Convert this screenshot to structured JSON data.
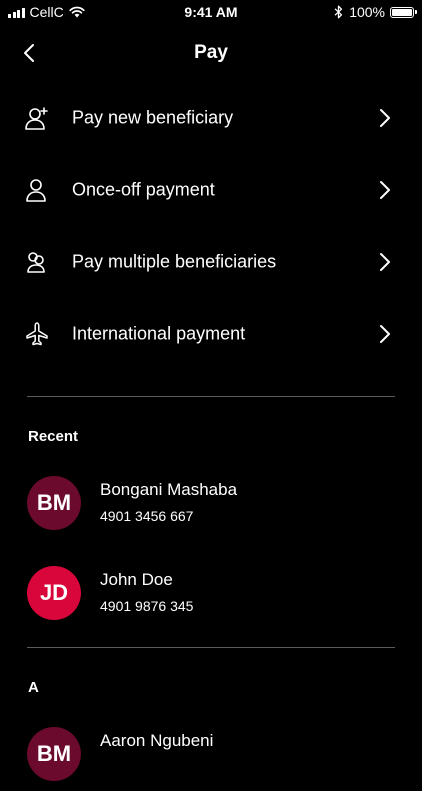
{
  "status_bar": {
    "carrier": "CellC",
    "time": "9:41 AM",
    "battery": "100%"
  },
  "header": {
    "title": "Pay",
    "back_icon": "chevron-left-icon"
  },
  "menu": [
    {
      "label": "Pay new beneficiary",
      "icon": "add-person-icon"
    },
    {
      "label": "Once-off payment",
      "icon": "person-icon"
    },
    {
      "label": "Pay multiple beneficiaries",
      "icon": "multiple-people-icon"
    },
    {
      "label": "International payment",
      "icon": "airplane-icon"
    }
  ],
  "recent": {
    "heading": "Recent",
    "contacts": [
      {
        "initials": "BM",
        "name": "Bongani Mashaba",
        "number": "4901 3456 667",
        "color": "#6b0a2c"
      },
      {
        "initials": "JD",
        "name": "John Doe",
        "number": "4901 9876 345",
        "color": "#d8063a"
      }
    ]
  },
  "alphabetical": {
    "heading": "A",
    "contacts": [
      {
        "initials": "BM",
        "name": "Aaron Ngubeni",
        "color": "#6b0a2c"
      }
    ]
  },
  "colors": {
    "background": "#000000",
    "text": "#ffffff",
    "divider": "#5a5a5a"
  }
}
